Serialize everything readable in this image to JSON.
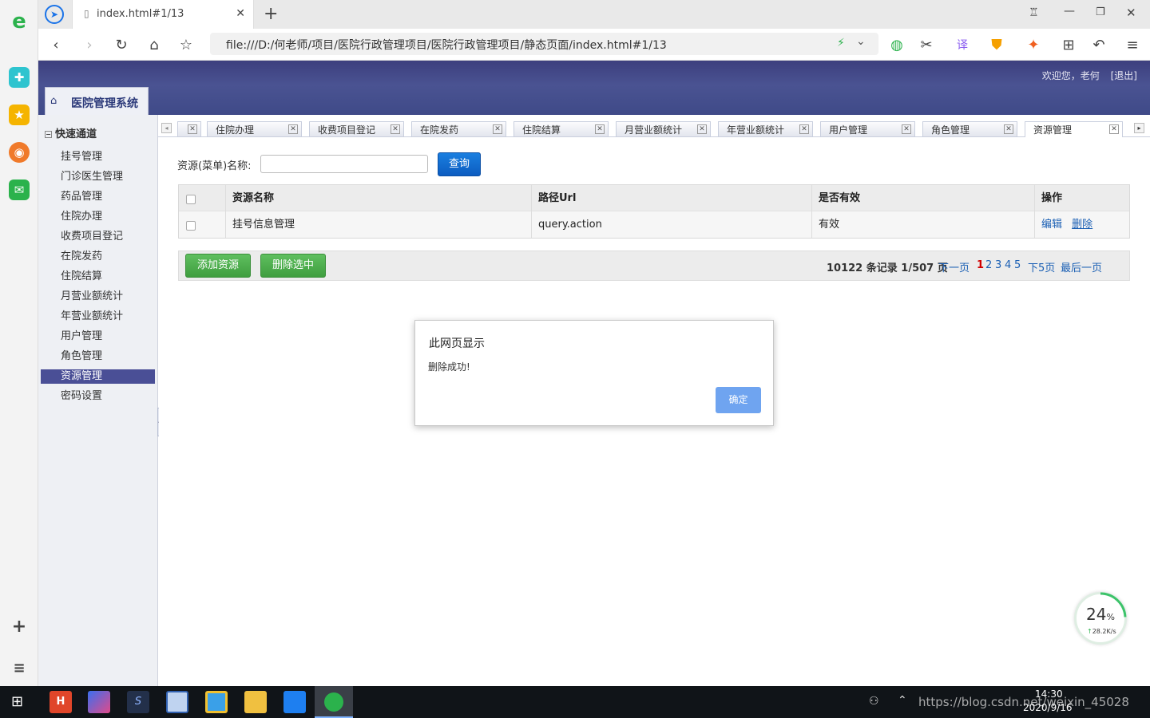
{
  "browser": {
    "tab_title": "index.html#1/13",
    "address": "file:///D:/何老师/项目/医院行政管理项目/医院行政管理项目/静态页面/index.html#1/13"
  },
  "header": {
    "welcome": "欢迎您，老何",
    "logout": "[退出]",
    "system_title": "医院管理系统"
  },
  "sidebar": {
    "title": "快速通道",
    "items": [
      {
        "label": "挂号管理"
      },
      {
        "label": "门诊医生管理"
      },
      {
        "label": "药品管理"
      },
      {
        "label": "住院办理"
      },
      {
        "label": "收费项目登记"
      },
      {
        "label": "在院发药"
      },
      {
        "label": "住院结算"
      },
      {
        "label": "月营业额统计"
      },
      {
        "label": "年营业额统计"
      },
      {
        "label": "用户管理"
      },
      {
        "label": "角色管理"
      },
      {
        "label": "资源管理",
        "active": true
      },
      {
        "label": "密码设置"
      }
    ]
  },
  "tabs": [
    {
      "label": ""
    },
    {
      "label": "住院办理"
    },
    {
      "label": "收费项目登记"
    },
    {
      "label": "在院发药"
    },
    {
      "label": "住院结算"
    },
    {
      "label": "月营业额统计"
    },
    {
      "label": "年营业额统计"
    },
    {
      "label": "用户管理"
    },
    {
      "label": "角色管理"
    },
    {
      "label": "资源管理",
      "active": true
    }
  ],
  "search": {
    "label": "资源(菜单)名称:",
    "value": "",
    "button": "查询"
  },
  "table": {
    "columns": [
      "资源名称",
      "路径Url",
      "是否有效",
      "操作"
    ],
    "rows": [
      {
        "name": "挂号信息管理",
        "url": "query.action",
        "valid": "有效",
        "edit": "编辑",
        "delete": "删除"
      }
    ]
  },
  "pager": {
    "add_button": "添加资源",
    "delete_selected_button": "删除选中",
    "info": "10122 条记录 1/507 页",
    "next": "下一页",
    "pages": [
      "1",
      "2",
      "3",
      "4",
      "5"
    ],
    "current_page": "1",
    "next5": "下5页",
    "last": "最后一页"
  },
  "dialog": {
    "title": "此网页显示",
    "message": "删除成功!",
    "ok": "确定"
  },
  "speed_widget": {
    "percent": "24",
    "rate": "28.2K/s"
  },
  "taskbar": {
    "time": "14:30",
    "date": "2020/9/16",
    "watermark": "https://blog.csdn.net/weixin_45028"
  }
}
